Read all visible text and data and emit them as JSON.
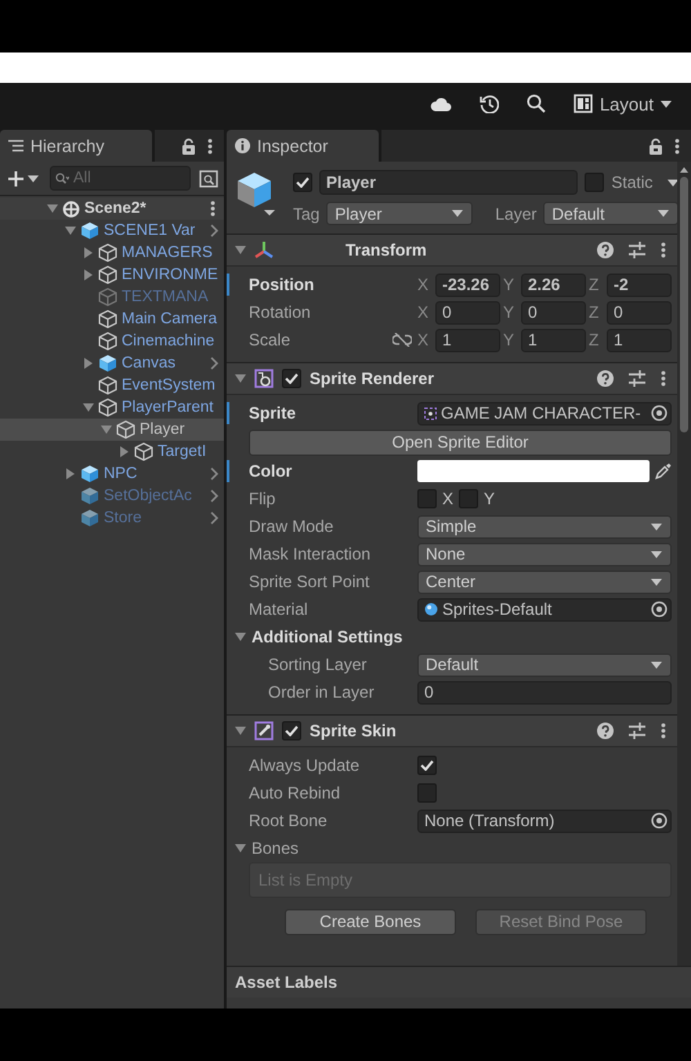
{
  "toolbar": {
    "layout_button": "Layout"
  },
  "hierarchy": {
    "tab": "Hierarchy",
    "search": {
      "placeholder": "All"
    },
    "scene": {
      "label": "Scene2*",
      "expanded": true,
      "children": [
        {
          "label": "SCENE1 Var",
          "kind": "prefab",
          "expanded": true,
          "selected": false,
          "disabled": false,
          "prefab_link": true,
          "children": [
            {
              "label": "MANAGERS",
              "kind": "object",
              "expanded": false,
              "selected": false,
              "disabled": false,
              "prefab_link": false
            },
            {
              "label": "ENVIRONME",
              "kind": "object",
              "expanded": false,
              "selected": false,
              "disabled": false,
              "prefab_link": false
            },
            {
              "label": "TEXTMANA",
              "kind": "object",
              "selected": false,
              "disabled": true,
              "prefab_link": false
            },
            {
              "label": "Main Camera",
              "kind": "object",
              "selected": false,
              "disabled": false,
              "prefab_link": false
            },
            {
              "label": "Cinemachine",
              "kind": "object",
              "selected": false,
              "disabled": false,
              "prefab_link": false
            },
            {
              "label": "Canvas",
              "kind": "prefab",
              "expanded": false,
              "selected": false,
              "disabled": false,
              "prefab_link": true
            },
            {
              "label": "EventSystem",
              "kind": "object",
              "selected": false,
              "disabled": false,
              "prefab_link": false
            },
            {
              "label": "PlayerParent",
              "kind": "object",
              "expanded": true,
              "selected": false,
              "disabled": false,
              "prefab_link": false,
              "children": [
                {
                  "label": "Player",
                  "kind": "object",
                  "expanded": true,
                  "selected": true,
                  "disabled": false,
                  "prefab_link": false,
                  "children": [
                    {
                      "label": "TargetI",
                      "kind": "object",
                      "expanded": false,
                      "selected": false,
                      "disabled": false,
                      "prefab_link": false
                    }
                  ]
                }
              ]
            }
          ]
        },
        {
          "label": "NPC",
          "kind": "prefab",
          "expanded": false,
          "selected": false,
          "disabled": false,
          "prefab_link": true
        },
        {
          "label": "SetObjectAc",
          "kind": "prefab",
          "selected": false,
          "disabled": true,
          "prefab_link": true
        },
        {
          "label": "Store",
          "kind": "prefab",
          "selected": false,
          "disabled": true,
          "prefab_link": true
        }
      ]
    }
  },
  "inspector": {
    "tab": "Inspector",
    "object": {
      "active": true,
      "name": "Player",
      "static": false,
      "static_label": "Static",
      "tag_label": "Tag",
      "tag": "Player",
      "layer_label": "Layer",
      "layer": "Default"
    },
    "components": [
      {
        "title": "Transform",
        "kind": "transform",
        "expanded": true,
        "rows": [
          {
            "kind": "vector3",
            "label": "Position",
            "modified": true,
            "values": [
              {
                "axis": "X",
                "value": "-23.26"
              },
              {
                "axis": "Y",
                "value": "2.26"
              },
              {
                "axis": "Z",
                "value": "-2"
              }
            ]
          },
          {
            "kind": "vector3",
            "label": "Rotation",
            "modified": false,
            "values": [
              {
                "axis": "X",
                "value": "0"
              },
              {
                "axis": "Y",
                "value": "0"
              },
              {
                "axis": "Z",
                "value": "0"
              }
            ]
          },
          {
            "kind": "vector3",
            "label": "Scale",
            "modified": false,
            "constrained": false,
            "values": [
              {
                "axis": "X",
                "value": "1"
              },
              {
                "axis": "Y",
                "value": "1"
              },
              {
                "axis": "Z",
                "value": "1"
              }
            ]
          }
        ]
      },
      {
        "title": "Sprite Renderer",
        "kind": "sprite-renderer",
        "enabled": true,
        "expanded": true,
        "rows": [
          {
            "kind": "sprite-object",
            "label": "Sprite",
            "modified": true,
            "value": "GAME JAM CHARACTER-"
          },
          {
            "kind": "button",
            "label": "Open Sprite Editor"
          },
          {
            "kind": "color",
            "label": "Color",
            "modified": true,
            "color": "#ffffff"
          },
          {
            "kind": "flip",
            "label": "Flip",
            "modified": false,
            "values": [
              {
                "axis": "X",
                "checked": false
              },
              {
                "axis": "Y",
                "checked": false
              }
            ]
          },
          {
            "kind": "dropdown",
            "label": "Draw Mode",
            "modified": false,
            "value": "Simple"
          },
          {
            "kind": "dropdown",
            "label": "Mask Interaction",
            "modified": false,
            "value": "None"
          },
          {
            "kind": "dropdown",
            "label": "Sprite Sort Point",
            "modified": false,
            "value": "Center"
          },
          {
            "kind": "material-object",
            "label": "Material",
            "modified": false,
            "value": "Sprites-Default"
          },
          {
            "kind": "foldout",
            "label": "Additional Settings",
            "expanded": true,
            "rows": [
              {
                "kind": "dropdown",
                "label": "Sorting Layer",
                "modified": false,
                "value": "Default"
              },
              {
                "kind": "input",
                "label": "Order in Layer",
                "modified": false,
                "value": "0"
              }
            ]
          }
        ]
      },
      {
        "title": "Sprite Skin",
        "kind": "sprite-skin",
        "enabled": true,
        "expanded": true,
        "rows": [
          {
            "kind": "checkbox",
            "label": "Always Update",
            "modified": false,
            "checked": true
          },
          {
            "kind": "checkbox",
            "label": "Auto Rebind",
            "modified": false,
            "checked": false
          },
          {
            "kind": "object",
            "label": "Root Bone",
            "modified": false,
            "value": "None (Transform)"
          },
          {
            "kind": "foldout",
            "label": "Bones",
            "expanded": true,
            "rows": []
          },
          {
            "kind": "list",
            "text": "List is Empty"
          },
          {
            "kind": "buttons",
            "items": [
              {
                "label": "Create Bones",
                "disabled": false
              },
              {
                "label": "Reset Bind Pose",
                "disabled": true
              }
            ]
          }
        ]
      }
    ],
    "footer": "Asset Labels"
  }
}
